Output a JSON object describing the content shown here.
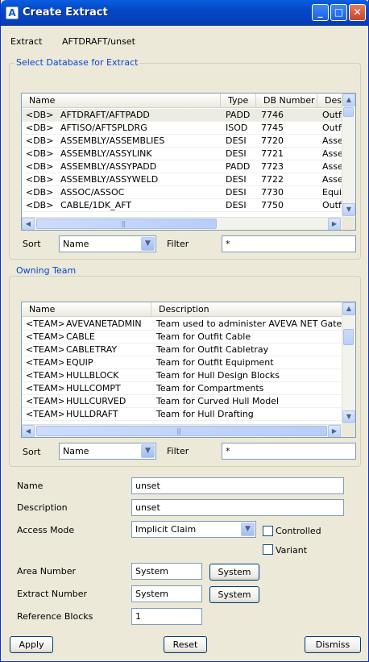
{
  "window": {
    "title": "Create Extract"
  },
  "extract": {
    "label": "Extract",
    "value": "AFTDRAFT/unset"
  },
  "db_group": {
    "title": "Select Database for Extract",
    "columns": [
      "Name",
      "Type",
      "DB Number",
      "Desc"
    ],
    "rows": [
      {
        "tag": "<DB>",
        "name": "AFTDRAFT/AFTPADD",
        "type": "PADD",
        "num": "7746",
        "desc": "Outfi"
      },
      {
        "tag": "<DB>",
        "name": "AFTISO/AFTSPLDRG",
        "type": "ISOD",
        "num": "7745",
        "desc": "Outfi"
      },
      {
        "tag": "<DB>",
        "name": "ASSEMBLY/ASSEMBLIES",
        "type": "DESI",
        "num": "7720",
        "desc": "Asse"
      },
      {
        "tag": "<DB>",
        "name": "ASSEMBLY/ASSYLINK",
        "type": "DESI",
        "num": "7721",
        "desc": "Asse"
      },
      {
        "tag": "<DB>",
        "name": "ASSEMBLY/ASSYPADD",
        "type": "PADD",
        "num": "7723",
        "desc": "Asse"
      },
      {
        "tag": "<DB>",
        "name": "ASSEMBLY/ASSYWELD",
        "type": "DESI",
        "num": "7722",
        "desc": "Asse"
      },
      {
        "tag": "<DB>",
        "name": "ASSOC/ASSOC",
        "type": "DESI",
        "num": "7730",
        "desc": "Equip"
      },
      {
        "tag": "<DB>",
        "name": "CABLE/1DK_AFT",
        "type": "DESI",
        "num": "7750",
        "desc": "Outfi"
      }
    ],
    "sort_label": "Sort",
    "sort_value": "Name",
    "filter_label": "Filter",
    "filter_value": "*"
  },
  "team_group": {
    "title": "Owning Team",
    "columns": [
      "Name",
      "Description"
    ],
    "rows": [
      {
        "tag": "<TEAM>",
        "name": "AVEVANETADMIN",
        "desc": "Team used to administer AVEVA NET Gateways"
      },
      {
        "tag": "<TEAM>",
        "name": "CABLE",
        "desc": "Team for Outfit Cable"
      },
      {
        "tag": "<TEAM>",
        "name": "CABLETRAY",
        "desc": "Team for Outfit Cabletray"
      },
      {
        "tag": "<TEAM>",
        "name": "EQUIP",
        "desc": "Team for Outfit Equipment"
      },
      {
        "tag": "<TEAM>",
        "name": "HULLBLOCK",
        "desc": "Team for Hull Design Blocks"
      },
      {
        "tag": "<TEAM>",
        "name": "HULLCOMPT",
        "desc": "Team for Compartments"
      },
      {
        "tag": "<TEAM>",
        "name": "HULLCURVED",
        "desc": "Team for Curved Hull Model"
      },
      {
        "tag": "<TEAM>",
        "name": "HULLDRAFT",
        "desc": "Team for Hull Drafting"
      }
    ],
    "sort_label": "Sort",
    "sort_value": "Name",
    "filter_label": "Filter",
    "filter_value": "*"
  },
  "form": {
    "name_label": "Name",
    "name_value": "unset",
    "description_label": "Description",
    "description_value": "unset",
    "access_label": "Access Mode",
    "access_value": "Implicit Claim",
    "controlled_label": "Controlled",
    "variant_label": "Variant",
    "area_label": "Area Number",
    "area_value": "System",
    "area_button": "System",
    "extract_number_label": "Extract Number",
    "extract_number_value": "System",
    "extract_number_button": "System",
    "ref_blocks_label": "Reference Blocks",
    "ref_blocks_value": "1"
  },
  "buttons": {
    "apply": "Apply",
    "reset": "Reset",
    "dismiss": "Dismiss"
  }
}
